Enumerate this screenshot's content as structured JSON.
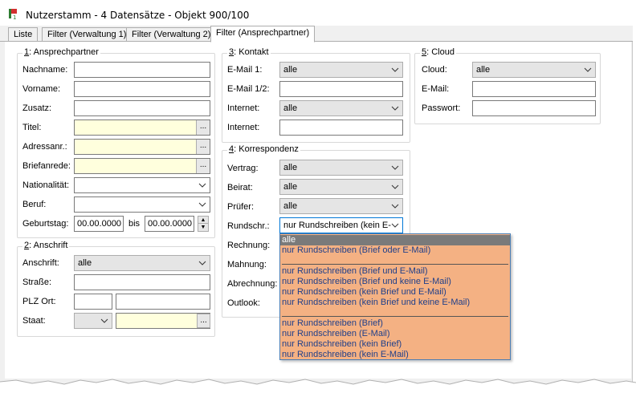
{
  "window": {
    "title": "Nutzerstamm - 4 Datensätze - Objekt 900/100",
    "icon": "app-icon-flag"
  },
  "tabs": [
    {
      "label": "Liste"
    },
    {
      "label": "Filter (Verwaltung 1)"
    },
    {
      "label": "Filter (Verwaltung 2)"
    },
    {
      "label": "Filter (Ansprechpartner)"
    }
  ],
  "ansprechpartner": {
    "legend_num": "1",
    "legend_text": ": Ansprechpartner",
    "fields": {
      "nachname": {
        "label": "Nachname:",
        "value": ""
      },
      "vorname": {
        "label": "Vorname:",
        "value": ""
      },
      "zusatz": {
        "label": "Zusatz:",
        "value": ""
      },
      "titel": {
        "label": "Titel:",
        "value": "",
        "button": "..."
      },
      "adressanr": {
        "label": "Adressanr.:",
        "value": "",
        "button": "..."
      },
      "briefanrede": {
        "label": "Briefanrede:",
        "value": "",
        "button": "..."
      },
      "nationalitaet": {
        "label": "Nationalität:",
        "value": ""
      },
      "beruf": {
        "label": "Beruf:",
        "value": ""
      },
      "geburtstag": {
        "label": "Geburtstag:",
        "from": "00.00.0000",
        "bis_label": "bis",
        "to": "00.00.0000"
      }
    }
  },
  "anschrift": {
    "legend_num": "2",
    "legend_text": ": Anschrift",
    "fields": {
      "anschrift": {
        "label": "Anschrift:",
        "value": "alle"
      },
      "strasse": {
        "label": "Straße:",
        "value": ""
      },
      "plzort": {
        "label": "PLZ Ort:",
        "plz": "",
        "ort": ""
      },
      "staat": {
        "label": "Staat:",
        "value": "",
        "button": "..."
      }
    }
  },
  "kontakt": {
    "legend_num": "3",
    "legend_text": ": Kontakt",
    "fields": {
      "email1": {
        "label": "E-Mail 1:",
        "value": "alle"
      },
      "email12": {
        "label": "E-Mail 1/2:",
        "value": ""
      },
      "internet_sel": {
        "label": "Internet:",
        "value": "alle"
      },
      "internet_txt": {
        "label": "Internet:",
        "value": ""
      }
    }
  },
  "korrespondenz": {
    "legend_num": "4",
    "legend_text": ": Korrespondenz",
    "fields": {
      "vertrag": {
        "label": "Vertrag:",
        "value": "alle"
      },
      "beirat": {
        "label": "Beirat:",
        "value": "alle"
      },
      "pruefer": {
        "label": "Prüfer:",
        "value": "alle"
      },
      "rundschr": {
        "label": "Rundschr.:",
        "value": "nur Rundschreiben (kein E-"
      },
      "rechnung": {
        "label": "Rechnung:"
      },
      "mahnung": {
        "label": "Mahnung:"
      },
      "abrechnung": {
        "label": "Abrechnung:"
      },
      "outlook": {
        "label": "Outlook:"
      }
    }
  },
  "cloud": {
    "legend_num": "5",
    "legend_text": ": Cloud",
    "fields": {
      "cloud": {
        "label": "Cloud:",
        "value": "alle"
      },
      "email": {
        "label": "E-Mail:",
        "value": ""
      },
      "passwort": {
        "label": "Passwort:",
        "value": ""
      }
    }
  },
  "rundschreiben_dropdown": {
    "selected_index": 0,
    "groups": [
      [
        "alle",
        "nur Rundschreiben (Brief oder E-Mail)"
      ],
      [
        "nur Rundschreiben (Brief und E-Mail)",
        "nur Rundschreiben (Brief und keine E-Mail)",
        "nur Rundschreiben (kein Brief und E-Mail)",
        "nur Rundschreiben (kein Brief und keine E-Mail)"
      ],
      [
        "nur Rundschreiben (Brief)",
        "nur Rundschreiben (E-Mail)",
        "nur Rundschreiben (kein Brief)",
        "nur Rundschreiben (kein E-Mail)"
      ]
    ]
  },
  "colors": {
    "highlight_yellow": "#ffffdd",
    "dropdown_bg": "#f4b183",
    "dropdown_text": "#1f3f8a",
    "selected_bg": "#7a7a7a"
  }
}
